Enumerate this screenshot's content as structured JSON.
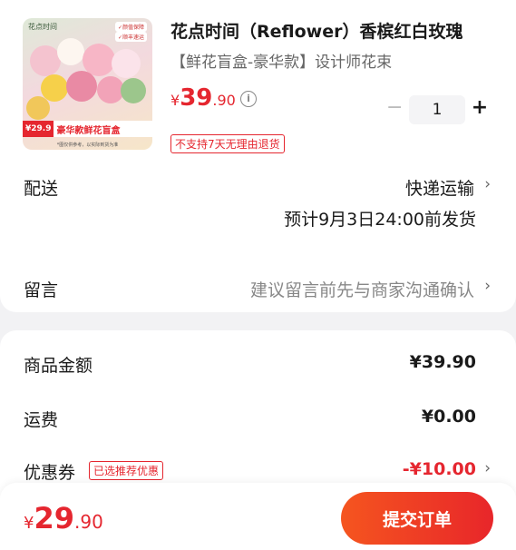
{
  "product": {
    "title": "花点时间（Reflower）香槟红白玫瑰",
    "subtitle": "【鲜花盲盒-豪华款】设计师花束",
    "price_yen": "¥",
    "price_int": "39",
    "price_dec": ".90",
    "info_icon": "i",
    "no_return": "不支持7天无理由退货",
    "quantity": "1",
    "minus": "−",
    "plus": "+",
    "image": {
      "brand": "花点时间",
      "tag1": "✓颜值保障",
      "tag2": "✓顺丰速运",
      "banner_price": "¥29.9",
      "banner_text": "豪华款鲜花盲盒",
      "footnote": "*图仅供参考，以实际到货为准"
    }
  },
  "delivery": {
    "label": "配送",
    "value": "快递运输",
    "eta": "预计9月3日24:00前发货"
  },
  "message": {
    "label": "留言",
    "placeholder": "建议留言前先与商家沟通确认"
  },
  "summary": {
    "amount_label": "商品金额",
    "amount_value": "¥39.90",
    "shipping_label": "运费",
    "shipping_value": "¥0.00",
    "coupon_label": "优惠券",
    "coupon_badge": "已选推荐优惠",
    "coupon_value": "-¥10.00"
  },
  "footer": {
    "total_yen": "¥",
    "total_int": "29",
    "total_dec": ".90",
    "submit_label": "提交订单"
  },
  "icons": {
    "chevron": "›"
  },
  "colors": {
    "accent": "#e5262f",
    "button_gradient_start": "#f5551f",
    "button_gradient_end": "#e8262a"
  }
}
